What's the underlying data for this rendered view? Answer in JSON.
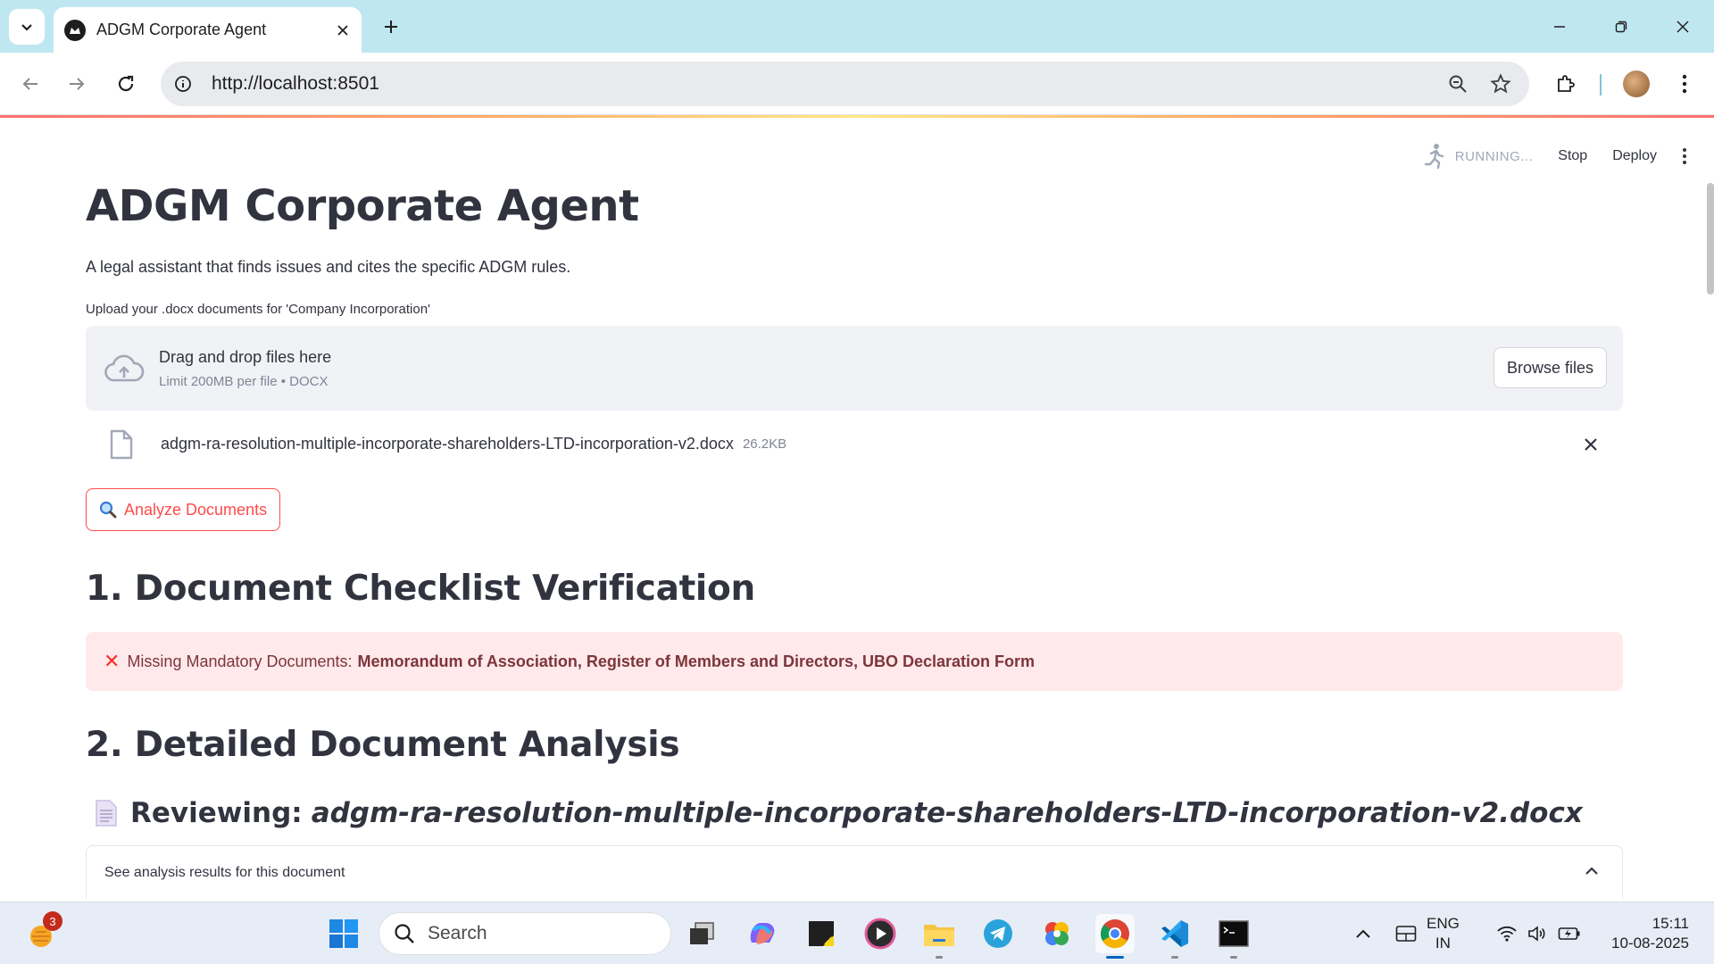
{
  "browser": {
    "tab_title": "ADGM Corporate Agent",
    "url": "http://localhost:8501"
  },
  "streamlit_header": {
    "status": "RUNNING...",
    "stop_label": "Stop",
    "deploy_label": "Deploy"
  },
  "page": {
    "title": "ADGM Corporate Agent",
    "caption": "A legal assistant that finds issues and cites the specific ADGM rules.",
    "uploader": {
      "label": "Upload your .docx documents for 'Company Incorporation'",
      "dropzone_main": "Drag and drop files here",
      "dropzone_sub": "Limit 200MB per file • DOCX",
      "browse_label": "Browse files",
      "file": {
        "name": "adgm-ra-resolution-multiple-incorporate-shareholders-LTD-incorporation-v2.docx",
        "size": "26.2KB"
      }
    },
    "analyze_label": "Analyze Documents",
    "section1_title": "1. Document Checklist Verification",
    "alert": {
      "prefix": "Missing Mandatory Documents:",
      "items": "Memorandum of Association, Register of Members and Directors, UBO Declaration Form"
    },
    "section2_title": "2. Detailed Document Analysis",
    "reviewing_label": "Reviewing:",
    "reviewing_file": "adgm-ra-resolution-multiple-incorporate-shareholders-LTD-incorporation-v2.docx",
    "expander_label": "See analysis results for this document"
  },
  "taskbar": {
    "notification_count": "3",
    "search_placeholder": "Search",
    "lang_line1": "ENG",
    "lang_line2": "IN",
    "time": "15:11",
    "date": "10-08-2025"
  },
  "colors": {
    "accent": "#ff4b4b",
    "alert_bg": "#ffe9ea",
    "alert_text": "#7d353b",
    "tabstrip": "#bfe7f1"
  }
}
